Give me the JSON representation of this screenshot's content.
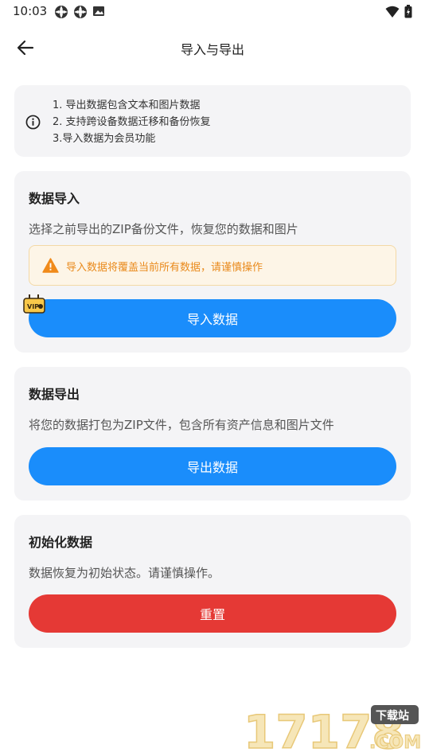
{
  "status_bar": {
    "time": "10:03"
  },
  "header": {
    "title": "导入与导出",
    "back_icon": "arrow-left-icon"
  },
  "info": {
    "lines": [
      "1. 导出数据包含文本和图片数据",
      "2. 支持跨设备数据迁移和备份恢复",
      "3.导入数据为会员功能"
    ]
  },
  "import_section": {
    "title": "数据导入",
    "description": "选择之前导出的ZIP备份文件，恢复您的数据和图片",
    "warning": "导入数据将覆盖当前所有数据，请谨慎操作",
    "vip_label": "VIP",
    "button_label": "导入数据"
  },
  "export_section": {
    "title": "数据导出",
    "description": "将您的数据打包为ZIP文件，包含所有资产信息和图片文件",
    "button_label": "导出数据"
  },
  "reset_section": {
    "title": "初始化数据",
    "description": "数据恢复为初始状态。请谨慎操作。",
    "button_label": "重置"
  },
  "watermark": {
    "number": "17178",
    "badge": "下载站",
    "domain": ".COM"
  },
  "colors": {
    "primary_button": "#1a8dfb",
    "danger_button": "#e53935",
    "warning_text": "#e98a1c",
    "warning_bg": "#fdf5e7",
    "card_bg": "#f4f4f6"
  }
}
